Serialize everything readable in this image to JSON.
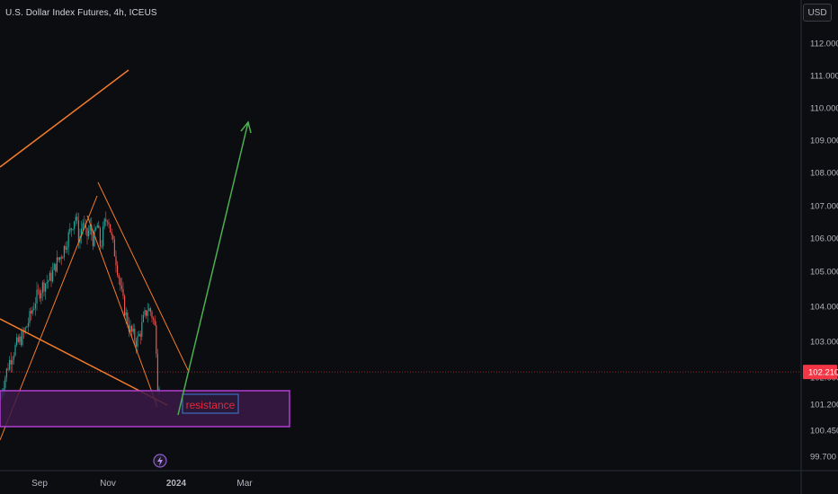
{
  "header": {
    "symbol_title": "U.S. Dollar Index Futures, 4h, ICEUS",
    "currency": "USD"
  },
  "chart_data": {
    "type": "candlestick",
    "title": "U.S. Dollar Index Futures, 4h, ICEUS",
    "y_ticks": [
      "112.000",
      "111.000",
      "110.000",
      "109.000",
      "108.000",
      "107.000",
      "106.000",
      "105.000",
      "104.000",
      "103.000",
      "102.000",
      "101.200",
      "100.450",
      "99.700"
    ],
    "x_ticks": [
      "Sep",
      "Nov",
      "2024",
      "Mar"
    ],
    "last_price": "102.210",
    "price_path": [
      [
        0,
        101.4
      ],
      [
        4,
        101.9
      ],
      [
        10,
        102.5
      ],
      [
        18,
        103.0
      ],
      [
        26,
        103.3
      ],
      [
        34,
        103.9
      ],
      [
        40,
        104.4
      ],
      [
        48,
        104.8
      ],
      [
        56,
        105.0
      ],
      [
        62,
        105.4
      ],
      [
        70,
        105.8
      ],
      [
        78,
        106.4
      ],
      [
        84,
        106.9
      ],
      [
        88,
        106.1
      ],
      [
        92,
        106.7
      ],
      [
        96,
        106.2
      ],
      [
        100,
        106.5
      ],
      [
        104,
        106.1
      ],
      [
        108,
        106.6
      ],
      [
        112,
        105.9
      ],
      [
        116,
        106.6
      ],
      [
        120,
        106.9
      ],
      [
        124,
        106.2
      ],
      [
        128,
        105.7
      ],
      [
        132,
        105.1
      ],
      [
        136,
        104.4
      ],
      [
        140,
        103.9
      ],
      [
        144,
        103.5
      ],
      [
        148,
        103.3
      ],
      [
        152,
        103.1
      ],
      [
        156,
        103.4
      ],
      [
        160,
        103.8
      ],
      [
        164,
        104.1
      ],
      [
        168,
        104.0
      ],
      [
        172,
        103.6
      ],
      [
        174,
        102.9
      ],
      [
        176,
        101.4
      ],
      [
        178,
        102.4
      ]
    ],
    "annotations": {
      "zone_label": "resistance"
    },
    "colors": {
      "up": "#26a69a",
      "down": "#ef5350",
      "trendline": "#f57c2b",
      "arrow": "#4caf50",
      "zone_border": "#b13fd1",
      "zone_fill": "#3b1a48",
      "zone_text": "#e8263a",
      "price_tag": "#f23645"
    }
  }
}
